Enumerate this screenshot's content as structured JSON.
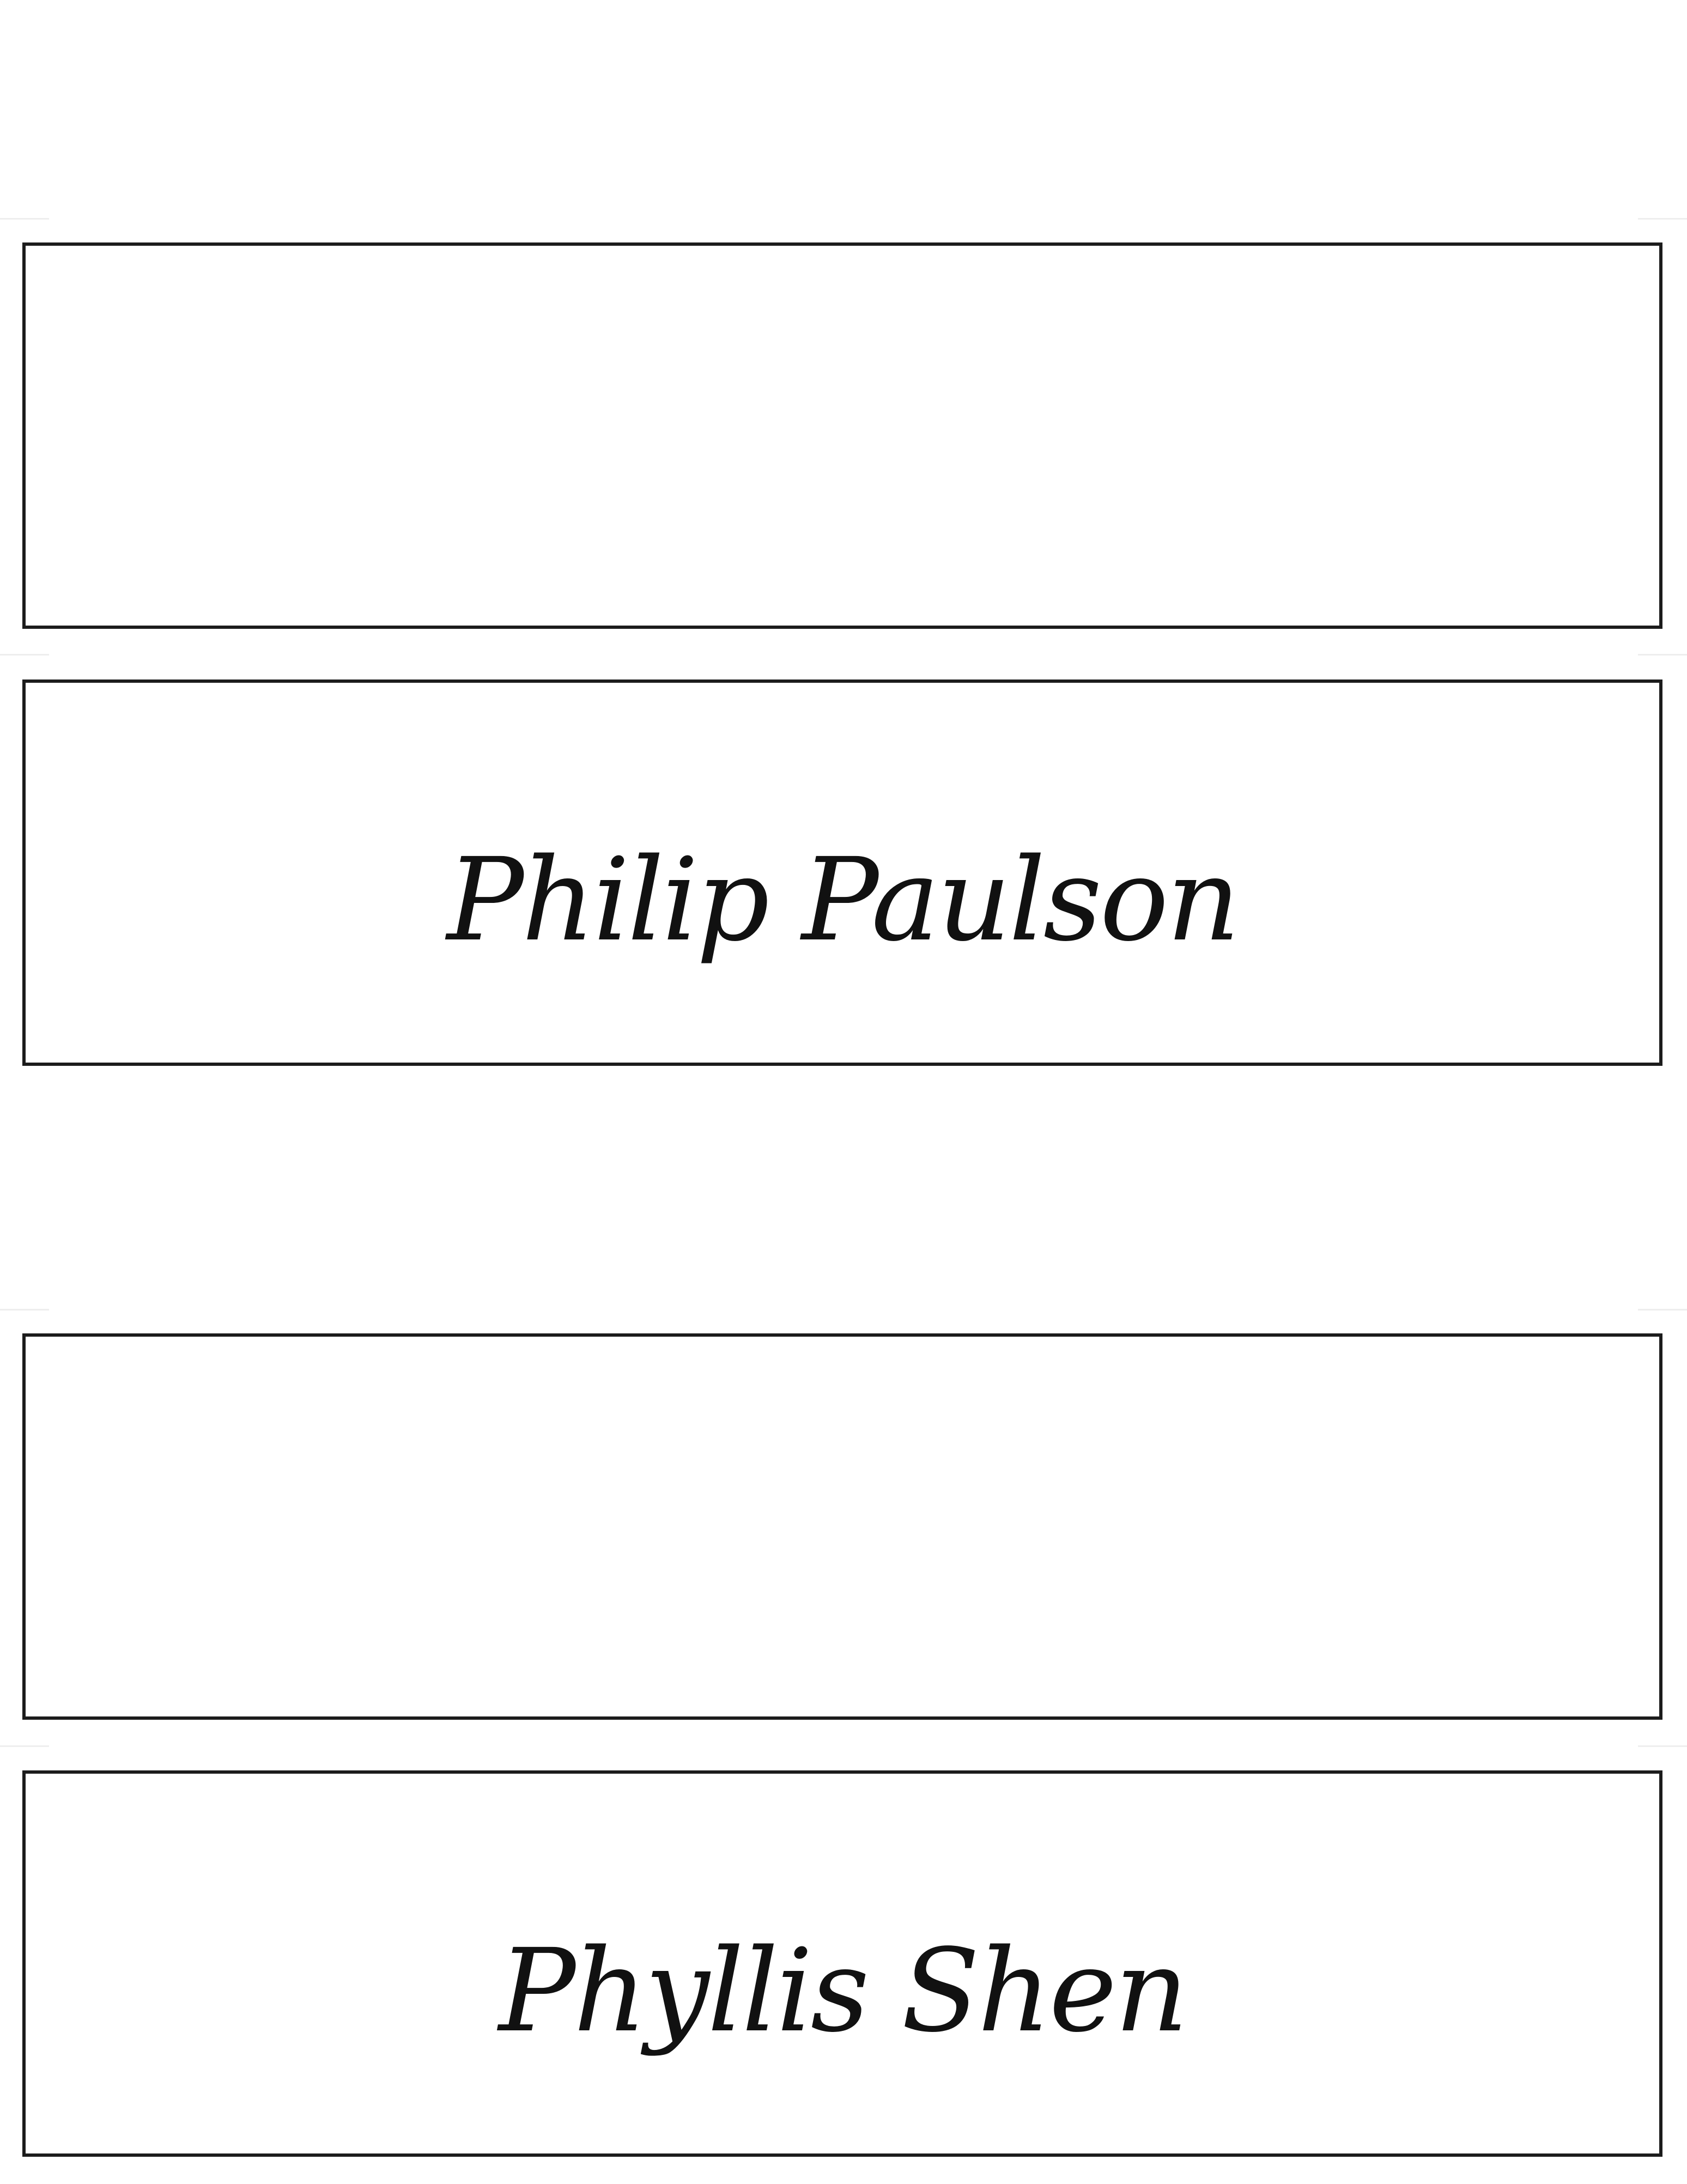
{
  "document": {
    "type": "place-card-sheet",
    "line_color": "#1c1c1c",
    "text_color": "#111111",
    "cards": [
      {
        "name": "Philip Paulson"
      },
      {
        "name": "Phyllis Shen"
      }
    ]
  }
}
